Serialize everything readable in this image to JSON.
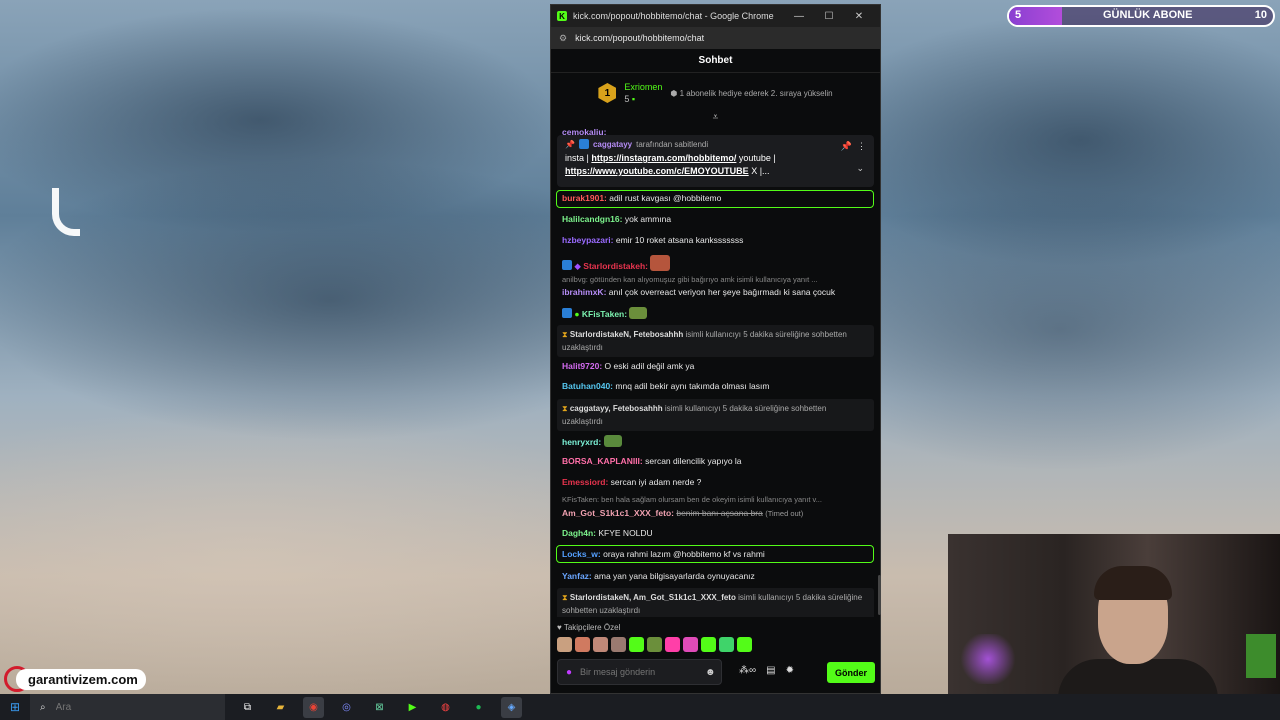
{
  "browser": {
    "window_title": "kick.com/popout/hobbitemo/chat - Google Chrome",
    "url": "kick.com/popout/hobbitemo/chat"
  },
  "goal": {
    "start": "5",
    "label": "GÜNLÜK ABONE",
    "end": "10",
    "progress": 0.2
  },
  "chat": {
    "header": "Sohbet",
    "leader": {
      "rank": "1",
      "name": "Exriomen",
      "count": "5",
      "message": "1 abonelik hediye ederek 2. sıraya yükselin"
    },
    "partial_user": "cemokaliu:",
    "pinned": {
      "author": "caggatayy",
      "author_suffix": "tarafından sabitlendi",
      "text_prefix": "insta |",
      "link1": "https://instagram.com/hobbitemo/",
      "text_mid": "youtube |",
      "link2": "https://www.youtube.com/c/EMOYOUTUBE",
      "text_suffix": "X |..."
    },
    "messages": [
      {
        "user": "burak1901:",
        "text": "adil rust kavgası @hobbitemo"
      },
      {
        "user": "Halilcandgn16:",
        "text": "yok ammına"
      },
      {
        "user": "hzbeypazari:",
        "text": "emir 10 roket atsana kanksssssss"
      },
      {
        "user": "Starlordistakeh:",
        "text": ""
      },
      {
        "reply": "anilbvg: götünden kan alıyomuşuz gibi bağırıyo amk isimli kullanıcıya yanıt ..."
      },
      {
        "user": "ibrahimxK:",
        "text": "anıl çok overreact veriyon her şeye bağırmadı ki sana çocuk"
      },
      {
        "user": "KFisTaken:",
        "text": ""
      },
      {
        "user": "Halit9720:",
        "text": "O eski adil değil amk ya"
      },
      {
        "user": "Batuhan040:",
        "text": "mnq adil bekir aynı takımda olması lasım"
      },
      {
        "user": "henryxrd:",
        "text": ""
      },
      {
        "user": "BORSA_KAPLANIII:",
        "text": "sercan dilencilik yapıyo la"
      },
      {
        "user": "Emessiord:",
        "text": "sercan iyi adam nerde ?"
      },
      {
        "reply": "KFisTaken: ben hala sağlam olursam ben de okeyim isimli kullanıcıya yanıt v..."
      },
      {
        "user": "Am_Got_S1k1c1_XXX_feto:",
        "text": "benim banı açsana bra",
        "note": "(Timed out)"
      },
      {
        "user": "Dagh4n:",
        "text": "KFYE NOLDU"
      },
      {
        "user": "Locks_w:",
        "text": "oraya rahmi lazım @hobbitemo kf vs rahmi"
      },
      {
        "user": "Yanfaz:",
        "text": "ama yan yana bilgisayarlarda oynuyacanız"
      }
    ],
    "system": [
      {
        "names": "StarlordistakeN, Fetebosahhh",
        "text": "isimli kullanıcıyı 5 dakika süreliğine sohbetten uzaklaştırdı"
      },
      {
        "names": "caggatayy, Fetebosahhh",
        "text": "isimli kullanıcıyı 5 dakika süreliğine sohbetten uzaklaştırdı"
      },
      {
        "names": "StarlordistakeN, Am_Got_S1k1c1_XXX_feto",
        "text": "isimli kullanıcıyı 5 dakika süreliğine sohbetten uzaklaştırdı"
      }
    ],
    "followers_only": "Takipçilere Özel",
    "composer_placeholder": "Bir mesaj gönderin",
    "send_label": "Gönder"
  },
  "logo_text": "garantivizem.com",
  "taskbar": {
    "search_placeholder": "Ara"
  },
  "colors": {
    "kick_green": "#53fc18",
    "chat_bg": "#0b0c0d",
    "goal_purple": "#8a3fd1"
  }
}
